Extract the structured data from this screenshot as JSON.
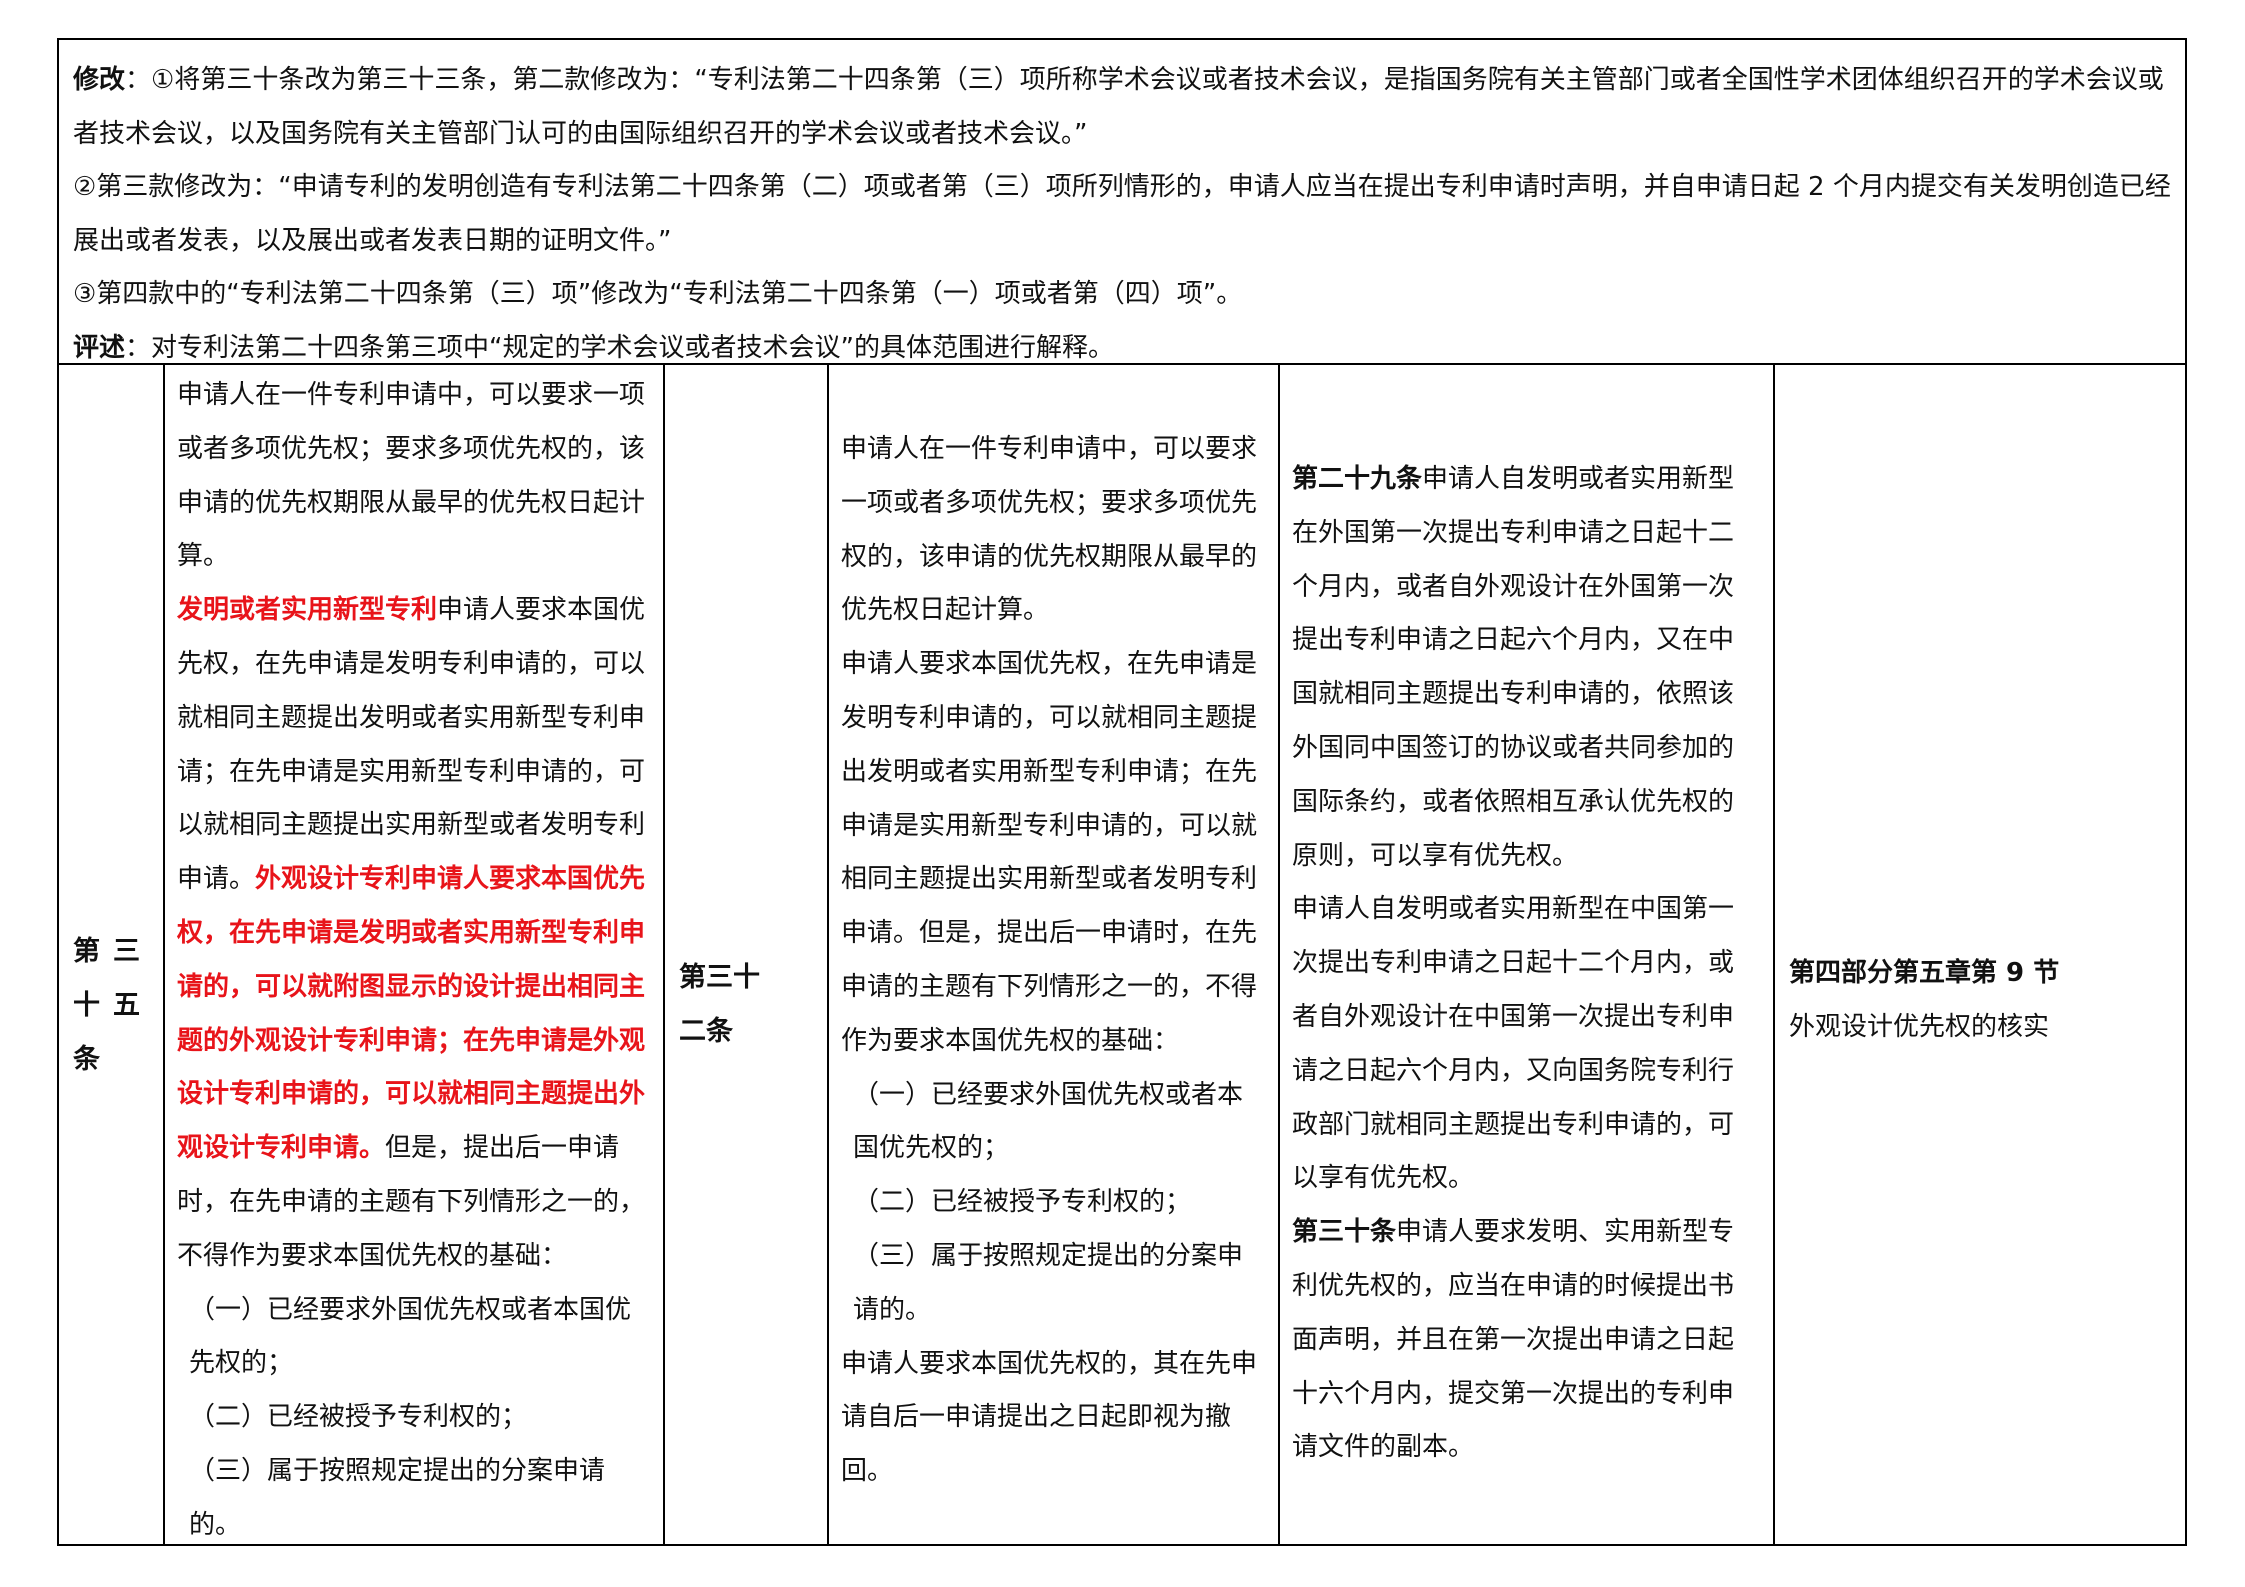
{
  "top": {
    "modify_label": "修改",
    "modify_line1": "：①将第三十条改为第三十三条，第二款修改为：“专利法第二十四条第（三）项所称学术会议或者技术会议，是指国务院有关主管部门或者全国性学术团体组织召开的学术会议或者技术会议，以及国务院有关主管部门认可的由国际组织召开的学术会议或者技术会议。”",
    "modify_line2": "②第三款修改为：“申请专利的发明创造有专利法第二十四条第（二）项或者第（三）项所列情形的，申请人应当在提出专利申请时声明，并自申请日起 2 个月内提交有关发明创造已经展出或者发表，以及展出或者发表日期的证明文件。”",
    "modify_line3": "③第四款中的“专利法第二十四条第（三）项”修改为“专利法第二十四条第（一）项或者第（四）项”。",
    "comment_label": "评述",
    "comment_text": "：对专利法第二十四条第三项中“规定的学术会议或者技术会议”的具体范围进行解释。"
  },
  "col1": {
    "label_a": "第",
    "label_b": "三",
    "label_c": "十",
    "label_d": "五",
    "label_e": "条"
  },
  "col2": {
    "p1": "申请人在一件专利申请中，可以要求一项或者多项优先权；要求多项优先权的，该申请的优先权期限从最早的优先权日起计算。",
    "p2_red": "发明或者实用新型专利",
    "p2_text": "申请人要求本国优先权，在先申请是发明专利申请的，可以就相同主题提出发明或者实用新型专利申请；在先申请是实用新型专利申请的，可以就相同主题提出实用新型或者发明专利申请。",
    "p2_bold_red": "外观设计专利申请人要求本国优先权，在先申请是发明或者实用新型专利申请的，可以就附图显示的设计提出相同主题的外观设计专利申请；在先申请是外观设计专利申请的，可以就相同主题提出外观设计专利申请。",
    "p2_tail": "但是，提出后一申请时，在先申请的主题有下列情形之一的，不得作为要求本国优先权的基础：",
    "item1": "（一）已经要求外国优先权或者本国优先权的；",
    "item2": "（二）已经被授予专利权的；",
    "item3": "（三）属于按照规定提出的分案申请的。"
  },
  "col3": {
    "label_line1": "第三十",
    "label_line2": "二条"
  },
  "col4": {
    "p1": "申请人在一件专利申请中，可以要求一项或者多项优先权；要求多项优先权的，该申请的优先权期限从最早的优先权日起计算。",
    "p2": "申请人要求本国优先权，在先申请是发明专利申请的，可以就相同主题提出发明或者实用新型专利申请；在先申请是实用新型专利申请的，可以就相同主题提出实用新型或者发明专利申请。但是，提出后一申请时，在先申请的主题有下列情形之一的，不得作为要求本国优先权的基础：",
    "item1": "（一）已经要求外国优先权或者本国优先权的；",
    "item2": "（二）已经被授予专利权的；",
    "item3": "（三）属于按照规定提出的分案申请的。",
    "p3": "申请人要求本国优先权的，其在先申请自后一申请提出之日起即视为撤回。"
  },
  "col5": {
    "art29_label": "第二十九条",
    "art29_p1": "申请人自发明或者实用新型在外国第一次提出专利申请之日起十二个月内，或者自外观设计在外国第一次提出专利申请之日起六个月内，又在中国就相同主题提出专利申请的，依照该外国同中国签订的协议或者共同参加的国际条约，或者依照相互承认优先权的原则，可以享有优先权。",
    "art29_p2": "申请人自发明或者实用新型在中国第一次提出专利申请之日起十二个月内，或者自外观设计在中国第一次提出专利申请之日起六个月内，又向国务院专利行政部门就相同主题提出专利申请的，可以享有优先权。",
    "art30_label": "第三十条",
    "art30_p1": "申请人要求发明、实用新型专利优先权的，应当在申请的时候提出书面声明，并且在第一次提出申请之日起十六个月内，提交第一次提出的专利申请文件的副本。"
  },
  "col6": {
    "ref_title": "第四部分第五章第 9 节",
    "ref_sub": "外观设计优先权的核实"
  },
  "colors": {
    "red": "#e8141a"
  }
}
